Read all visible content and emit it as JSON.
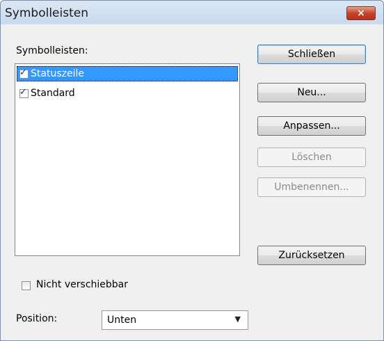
{
  "window": {
    "title": "Symbolleisten",
    "close_icon": "×"
  },
  "toolbars_label": "Symbolleisten:",
  "toolbars_list": [
    {
      "label": "Statuszeile",
      "checked": true,
      "selected": true
    },
    {
      "label": "Standard",
      "checked": true,
      "selected": false
    }
  ],
  "buttons": {
    "close": "Schließen",
    "new": "Neu...",
    "customize": "Anpassen...",
    "delete": "Löschen",
    "rename": "Umbenennen...",
    "reset": "Zurücksetzen"
  },
  "options": {
    "not_movable_label": "Nicht verschiebbar",
    "not_movable_checked": false,
    "position_label": "Position:",
    "position_value": "Unten"
  }
}
